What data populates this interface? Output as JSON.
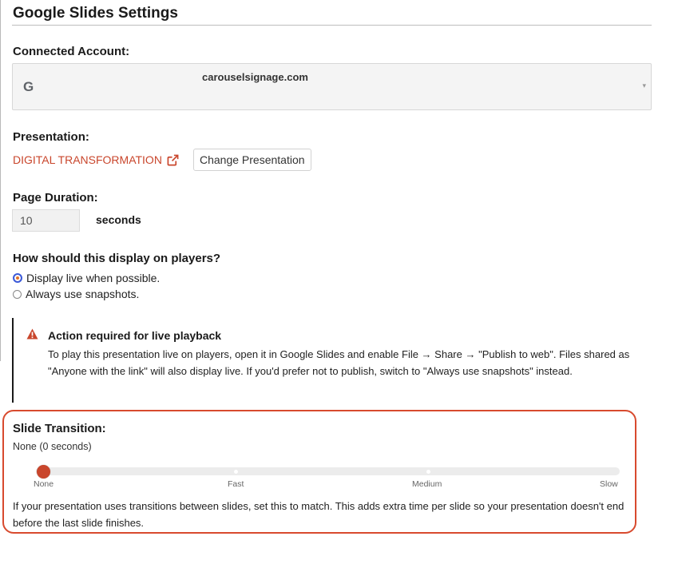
{
  "header": {
    "title": "Google Slides Settings"
  },
  "account": {
    "label": "Connected Account:",
    "icon": "google-g-icon",
    "icon_text": "G",
    "value": "carouselsignage.com",
    "caret": "▾"
  },
  "presentation": {
    "label": "Presentation:",
    "name": "DIGITAL TRANSFORMATION",
    "link_color": "#c9462c",
    "change_label": "Change Presentation"
  },
  "duration": {
    "label": "Page Duration:",
    "value": "10",
    "unit": "seconds"
  },
  "display_mode": {
    "label": "How should this display on players?",
    "options": [
      {
        "label": "Display live when possible.",
        "checked": true
      },
      {
        "label": "Always use snapshots.",
        "checked": false
      }
    ]
  },
  "alert": {
    "icon": "warning-triangle-icon",
    "title": "Action required for live playback",
    "body": "To play this presentation live on players, open it in Google Slides and enable File → Share → \"Publish to web\". Files shared as \"Anyone with the link\" will also display live. If you'd prefer not to publish, switch to \"Always use snapshots\" instead."
  },
  "transition": {
    "label": "Slide Transition:",
    "current": "None (0 seconds)",
    "ticks": [
      "None",
      "Fast",
      "Medium",
      "Slow"
    ],
    "selected_index": 0,
    "help": "If your presentation uses transitions between slides, set this to match. This adds extra time per slide so your presentation doesn't end before the last slide finishes.",
    "highlight_color": "#d84a2e"
  }
}
